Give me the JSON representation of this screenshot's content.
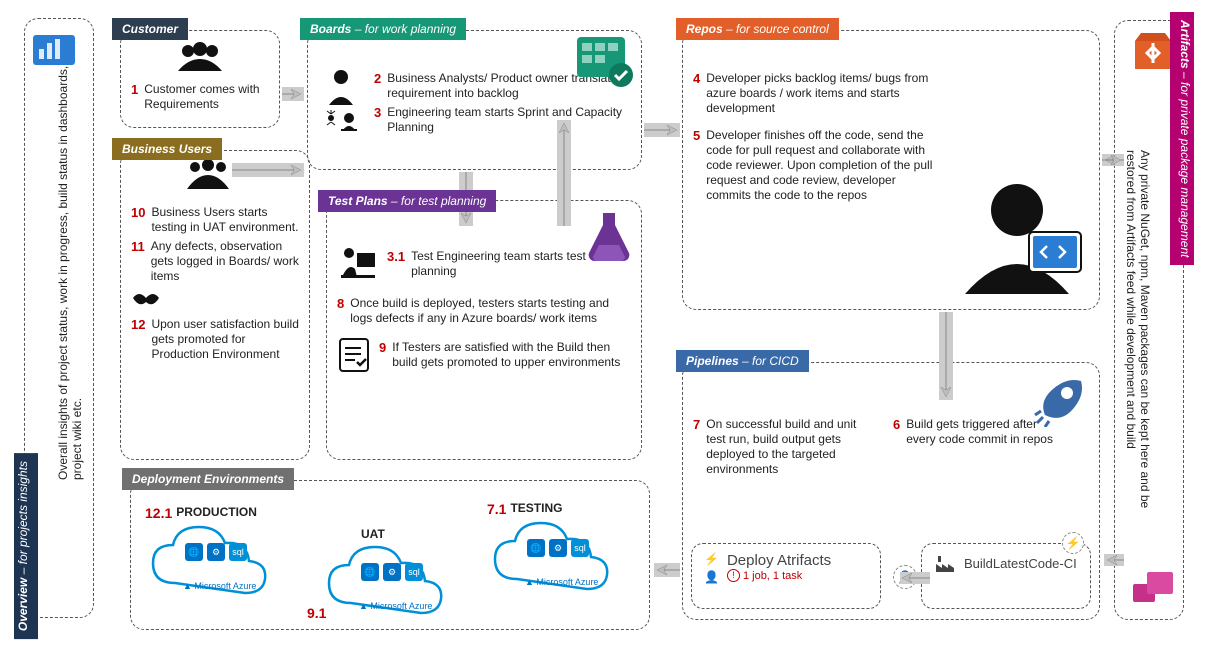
{
  "overview": {
    "title": "Overview",
    "sub": "– for projects insights",
    "desc": "Overall insights of project status, work in progress, build status in dashboards, project wiki etc."
  },
  "artifacts": {
    "title": "Artifacts",
    "sub": "– for private package management",
    "desc": "Any private NuGet, npm, Maven packages  can be kept here and be restored from Artifacts feed while development and build"
  },
  "customer": {
    "title": "Customer",
    "step1_num": "1",
    "step1": "Customer comes with Requirements"
  },
  "boards": {
    "title": "Boards",
    "sub": "– for work planning",
    "step2_num": "2",
    "step2": "Business Analysts/ Product owner translates requirement into  backlog",
    "step3_num": "3",
    "step3": "Engineering team starts Sprint and Capacity Planning"
  },
  "business": {
    "title": "Business Users",
    "step10_num": "10",
    "step10": "Business Users starts testing in UAT environment.",
    "step11_num": "11",
    "step11": "Any defects, observation gets logged in Boards/ work items",
    "step12_num": "12",
    "step12": "Upon user satisfaction build gets promoted for Production Environment"
  },
  "test": {
    "title": "Test Plans",
    "sub": "– for test planning",
    "step31_num": "3.1",
    "step31": "Test Engineering team starts test planning",
    "step8_num": "8",
    "step8": "Once build is deployed, testers starts testing and logs defects if any in Azure boards/ work items",
    "step9_num": "9",
    "step9": "If Testers are satisfied with the Build then build gets promoted to upper environments"
  },
  "repos": {
    "title": "Repos",
    "sub": "– for source control",
    "step4_num": "4",
    "step4": "Developer picks backlog items/ bugs from azure boards / work items and starts development",
    "step5_num": "5",
    "step5": "Developer finishes off the code, send the code for pull request and collaborate with code reviewer. Upon completion of the pull request and code review, developer commits the code to the repos"
  },
  "pipelines": {
    "title": "Pipelines",
    "sub": "– for CICD",
    "step7_num": "7",
    "step7": "On successful build and unit test run, build output gets deployed to the targeted environments",
    "step6_num": "6",
    "step6": "Build gets triggered after every code commit in repos",
    "deploy_title": "Deploy Atrifacts",
    "deploy_sub": "1 job, 1 task",
    "build_title": "BuildLatestCode-CI"
  },
  "deploy": {
    "title": "Deployment Environments",
    "prod_num": "12.1",
    "prod": "PRODUCTION",
    "uat_num": "9.1",
    "uat": "UAT",
    "test_num": "7.1",
    "test": "TESTING",
    "azure": "Microsoft Azure"
  },
  "warn_icon": "!"
}
